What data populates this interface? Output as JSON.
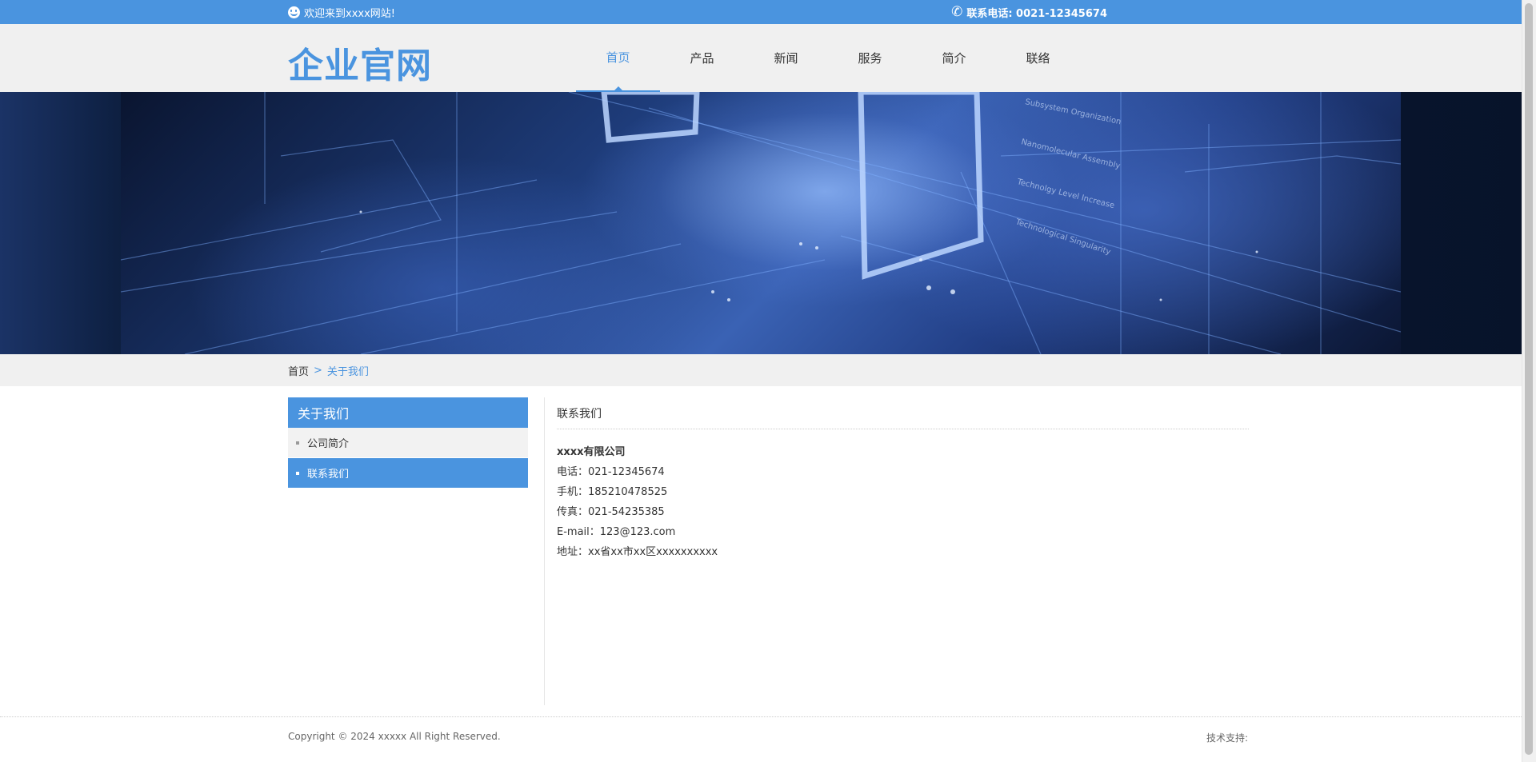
{
  "topbar": {
    "welcome": "欢迎来到xxxx网站!",
    "phone": "联系电话: 0021-12345674",
    "welcome_icon": "smile-icon",
    "phone_icon": "phone-icon"
  },
  "header": {
    "logo": "企业官网",
    "nav": [
      {
        "label": "首页",
        "active": true
      },
      {
        "label": "产品",
        "active": false
      },
      {
        "label": "新闻",
        "active": false
      },
      {
        "label": "服务",
        "active": false
      },
      {
        "label": "简介",
        "active": false
      },
      {
        "label": "联络",
        "active": false
      }
    ]
  },
  "banner": {
    "lines": [
      "Subsystem Organization",
      "Nanomolecular Assembly",
      "Technolgy Level Increase",
      "Technological Singularity"
    ]
  },
  "breadcrumb": {
    "home": "首页",
    "separator": ">",
    "current": "关于我们"
  },
  "sidebar": {
    "title": "关于我们",
    "items": [
      {
        "label": "公司简介",
        "active": false
      },
      {
        "label": "联系我们",
        "active": true
      }
    ]
  },
  "content": {
    "title": "联系我们",
    "company": "xxxx有限公司",
    "phone": "电话：021-12345674",
    "mobile": "手机：185210478525",
    "fax": "传真：021-54235385",
    "email": "E-mail：123@123.com",
    "address": "地址：xx省xx市xx区xxxxxxxxxx"
  },
  "footer": {
    "copyright": "Copyright © 2024 xxxxx All Right Reserved.",
    "tech": "技术支持:"
  },
  "colors": {
    "accent": "#4a94df",
    "header_bg": "#f0f0f0"
  }
}
